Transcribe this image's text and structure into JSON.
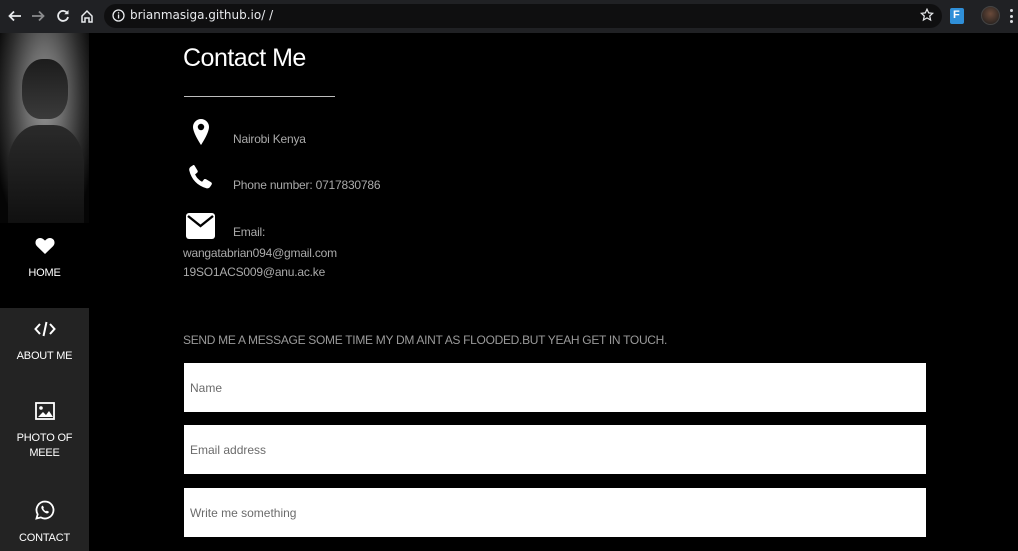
{
  "browser": {
    "url": "brianmasiga.github.io/ /",
    "icons": [
      "back-arrow-icon",
      "forward-arrow-icon",
      "reload-icon",
      "home-icon",
      "info-icon",
      "star-icon",
      "extension-icon",
      "profile-avatar",
      "menu-icon"
    ]
  },
  "sidebar": {
    "items": [
      {
        "label": "HOME",
        "icon": "heart-icon"
      },
      {
        "label": "ABOUT ME",
        "icon": "code-icon"
      },
      {
        "label": "PHOTO OF MEEE",
        "icon": "image-icon"
      },
      {
        "label": "CONTACT",
        "icon": "whatsapp-icon"
      }
    ]
  },
  "contact": {
    "title": "Contact Me",
    "location": "Nairobi Kenya",
    "phone": "Phone number: 0717830786",
    "email_label": "Email:",
    "email_1": "wangatabrian094@gmail.com",
    "email_2": "19SO1ACS009@anu.ac.ke"
  },
  "form": {
    "prompt": "SEND ME A MESSAGE SOME TIME MY DM AINT AS FLOODED.BUT YEAH GET IN TOUCH.",
    "name_placeholder": "Name",
    "email_placeholder": "Email address",
    "message_placeholder": "Write me something"
  },
  "colors": {
    "background": "#000000",
    "sidebar_dark": "#232323",
    "chrome": "#202124"
  }
}
